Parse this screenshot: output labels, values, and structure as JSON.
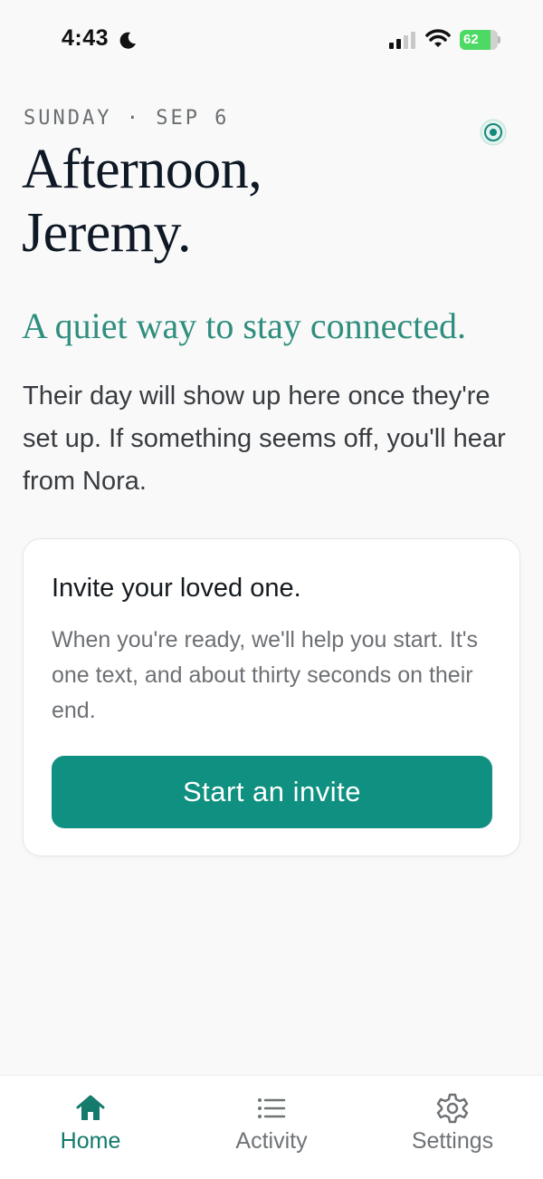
{
  "status_bar": {
    "time": "4:43",
    "battery": "62"
  },
  "header": {
    "date": "SUNDAY · SEP 6",
    "greeting_line1": "Afternoon,",
    "greeting_line2": "Jeremy."
  },
  "tagline": "A quiet way to stay connected.",
  "intro": "Their day will show up here once they're set up. If something seems off, you'll hear from Nora.",
  "invite_card": {
    "title": "Invite your loved one.",
    "body": "When you're ready, we'll help you start. It's one text, and about thirty seconds on their end.",
    "button_label": "Start an invite"
  },
  "tabs": [
    {
      "label": "Home",
      "icon": "home-icon",
      "active": true
    },
    {
      "label": "Activity",
      "icon": "list-icon",
      "active": false
    },
    {
      "label": "Settings",
      "icon": "gear-icon",
      "active": false
    }
  ],
  "colors": {
    "accent": "#0f9080",
    "accent_text": "#2f8e7e",
    "active_tab": "#147a6c",
    "background": "#f9f9f9",
    "battery": "#4cd964"
  }
}
